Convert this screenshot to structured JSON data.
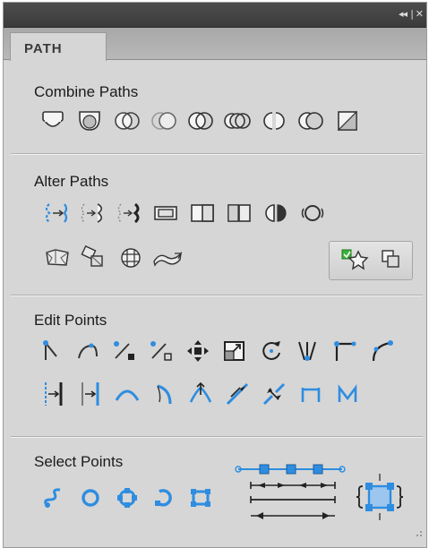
{
  "panel": {
    "tab_label": "PATH",
    "title_bar": {
      "collapse_glyph": "◂◂",
      "separator": "|",
      "close_glyph": "✕"
    }
  },
  "sections": {
    "combine": {
      "title": "Combine Paths"
    },
    "alter": {
      "title": "Alter Paths"
    },
    "edit": {
      "title": "Edit Points"
    },
    "select": {
      "title": "Select Points"
    }
  },
  "colors": {
    "panel_bg": "#d6d6d6",
    "title_bar": "#444444",
    "accent_blue": "#2e8de0",
    "icon_dark": "#3a3a3a",
    "mode_green": "#3cb33c"
  },
  "icons": {
    "combine": [
      "union-icon",
      "intersect-icon",
      "punch-icon",
      "crop-icon",
      "split-icon",
      "xor-icon",
      "join-icon",
      "divide-icon",
      "fragment-icon"
    ],
    "alter_row1": [
      "fillet-icon",
      "round-corners-icon",
      "taper-icon",
      "expand-stroke-icon",
      "inset-icon",
      "mirror-icon",
      "split-path-icon",
      "simplify-icon"
    ],
    "alter_row2": [
      "envelope-icon",
      "distort-icon",
      "grid-warp-icon",
      "twist-icon"
    ],
    "edit_row1": [
      "corner-point-icon",
      "curve-point-icon",
      "add-point-icon",
      "delete-point-icon",
      "move-point-icon",
      "scale-points-icon",
      "rotate-points-icon",
      "smooth-point-icon",
      "corner-handle-icon",
      "curve-handle-icon"
    ],
    "edit_row2": [
      "align-left-icon",
      "align-right-icon",
      "arc-icon",
      "bend-icon",
      "raise-icon",
      "straighten-icon",
      "disconnect-icon",
      "bridge-icon",
      "zigzag-icon"
    ],
    "select": [
      "select-first-icon",
      "select-all-icon",
      "select-opposite-icon",
      "select-next-icon",
      "select-bounds-icon",
      "point-spacing-icon",
      "fit-points-icon"
    ],
    "mode": [
      "add-mode-icon",
      "copy-mode-icon"
    ]
  }
}
